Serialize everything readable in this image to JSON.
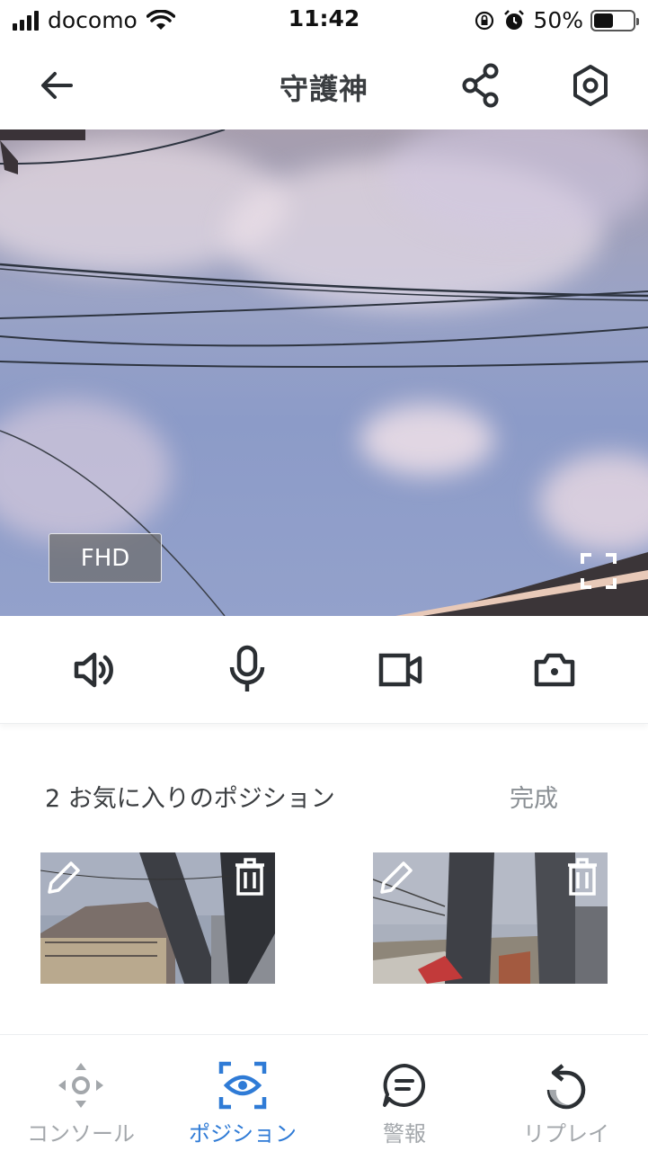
{
  "status_bar": {
    "carrier": "docomo",
    "time": "11:42",
    "battery": "50%",
    "battery_level": 0.5
  },
  "header": {
    "title": "守護神",
    "icons": {
      "back": "arrow-left-icon",
      "share": "share-icon",
      "settings": "gear-icon"
    }
  },
  "video": {
    "quality_badge": "FHD",
    "fullscreen_icon": "fullscreen-icon"
  },
  "controls": {
    "icons": [
      "speaker-icon",
      "microphone-icon",
      "video-camera-icon",
      "camera-icon"
    ]
  },
  "favorites": {
    "title": "2 お気に入りのポジション",
    "done_label": "完成",
    "cards": [
      {
        "edit_icon": "pencil-icon",
        "delete_icon": "trash-icon"
      },
      {
        "edit_icon": "pencil-icon",
        "delete_icon": "trash-icon"
      }
    ]
  },
  "tabs": [
    {
      "label": "コンソール",
      "icon": "dpad-icon",
      "active": false
    },
    {
      "label": "ポジション",
      "icon": "eye-focus-icon",
      "active": true
    },
    {
      "label": "警報",
      "icon": "message-icon",
      "active": false
    },
    {
      "label": "リプレイ",
      "icon": "replay-icon",
      "active": false
    }
  ],
  "colors": {
    "accent": "#2f7bd6",
    "icon": "#2b2f33",
    "inactive": "#a3a7ab"
  }
}
